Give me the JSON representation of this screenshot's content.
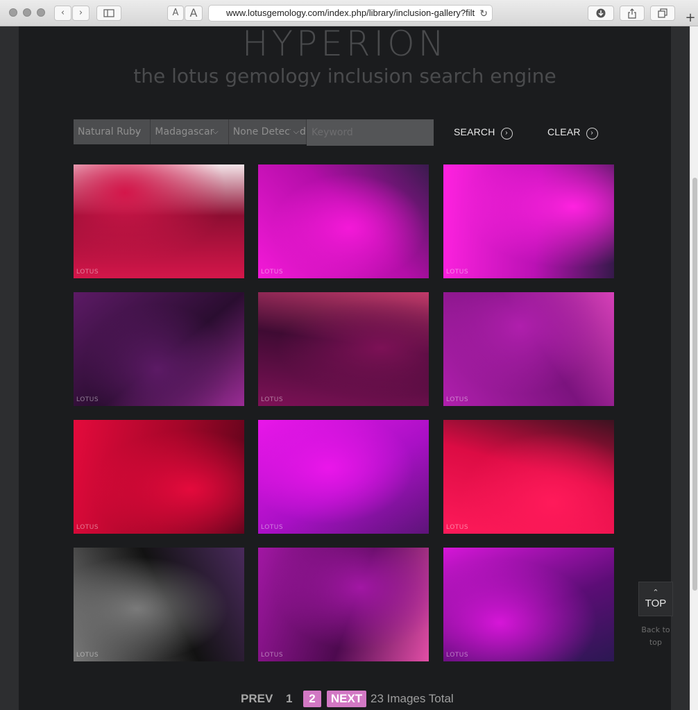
{
  "browser": {
    "url": "www.lotusgemology.com/index.php/library/inclusion-gallery?filt",
    "text_small": "A",
    "text_large": "A",
    "reload_glyph": "↻",
    "new_tab_glyph": "+"
  },
  "header": {
    "brand": "HYPERION",
    "tagline": "the lotus gemology inclusion search engine"
  },
  "filters": {
    "gem": "Natural Ruby",
    "origin": "Madagascar",
    "treatment": "None Detected",
    "keyword_placeholder": "Keyword",
    "search_label": "SEARCH",
    "clear_label": "CLEAR"
  },
  "gallery": {
    "watermark": "LOTUS",
    "images": [
      {
        "colors": [
          "#d4164a",
          "#8d0e32",
          "#f3e4e8"
        ]
      },
      {
        "colors": [
          "#f419d8",
          "#b30ea8",
          "#3a1b4e"
        ]
      },
      {
        "colors": [
          "#ff22e0",
          "#bb11b5",
          "#35194a"
        ]
      },
      {
        "colors": [
          "#5c1a65",
          "#2a0d30",
          "#9a2c95"
        ]
      },
      {
        "colors": [
          "#7d1156",
          "#3f0b33",
          "#c23a6a"
        ]
      },
      {
        "colors": [
          "#b01fad",
          "#7b137e",
          "#d640b8"
        ]
      },
      {
        "colors": [
          "#e40a3c",
          "#a50629",
          "#58041a"
        ]
      },
      {
        "colors": [
          "#ea16ea",
          "#a910c5",
          "#5d1479"
        ]
      },
      {
        "colors": [
          "#ff1a5a",
          "#dc0c44",
          "#3c1220"
        ]
      },
      {
        "colors": [
          "#7a7a7a",
          "#121212",
          "#4a2a5c"
        ]
      },
      {
        "colors": [
          "#a217a4",
          "#4d0a4f",
          "#e24fa6"
        ]
      },
      {
        "colors": [
          "#d616d8",
          "#5c0d76",
          "#2b1852"
        ]
      }
    ]
  },
  "pagination": {
    "prev": "PREV",
    "page1": "1",
    "page2": "2",
    "next": "NEXT",
    "total": "23 Images Total"
  },
  "top_button": {
    "label": "TOP",
    "caption_line1": "Back to",
    "caption_line2": "top"
  }
}
